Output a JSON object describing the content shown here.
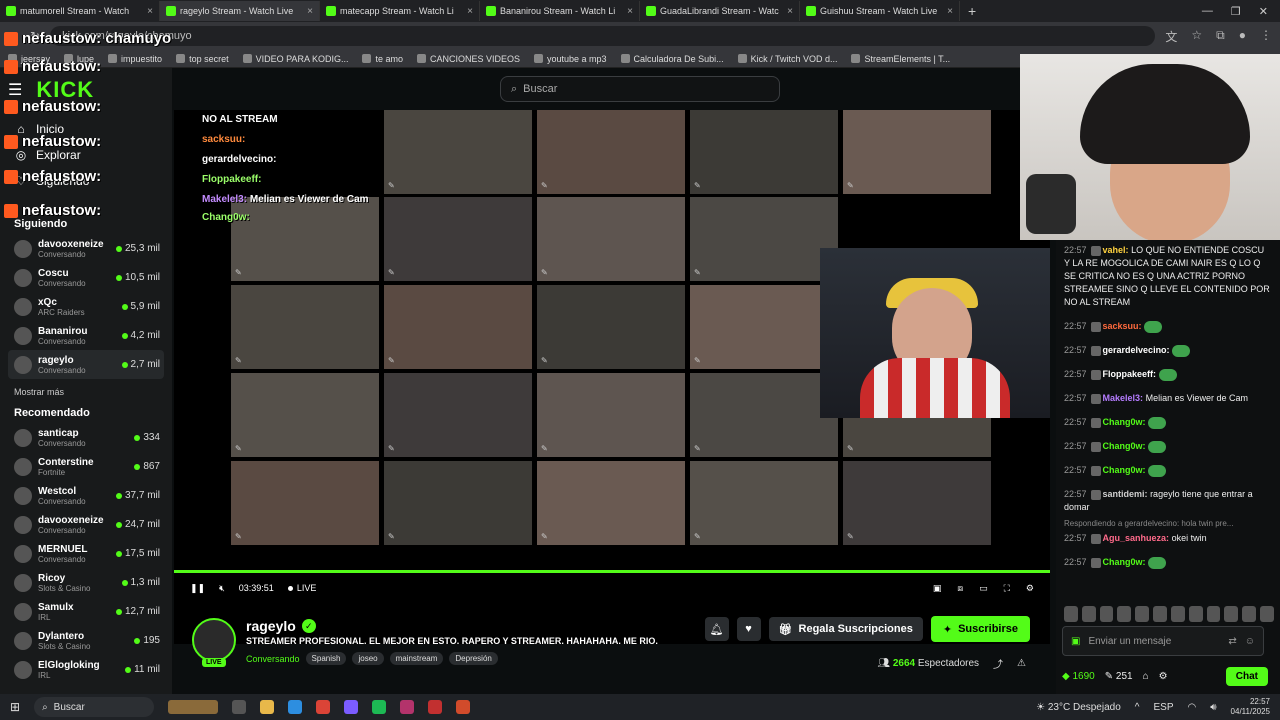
{
  "browser": {
    "tabs": [
      {
        "title": "matumorell Stream - Watch"
      },
      {
        "title": "rageylo Stream - Watch Live"
      },
      {
        "title": "matecapp Stream - Watch Li"
      },
      {
        "title": "Bananirou Stream - Watch Li"
      },
      {
        "title": "GuadaLibrandi Stream - Watc"
      },
      {
        "title": "Guishuu Stream - Watch Live"
      }
    ],
    "new_tab": "+",
    "address": "kick.com/rageylo/chamuyo",
    "bookmarks": [
      "jeersay",
      "lupe",
      "impuestito",
      "top secret",
      "VIDEO PARA KODIG...",
      "te amo",
      "CANCIONES VIDEOS",
      "youtube a mp3",
      "Calculadora De Subi...",
      "Kick / Twitch VOD d...",
      "StreamElements | T..."
    ]
  },
  "overlay_chat": [
    {
      "text": "nefaustow: chamuyo"
    },
    {
      "text": "nefaustow:"
    },
    {
      "text": "nefaustow:"
    },
    {
      "text": "nefaustow:"
    },
    {
      "text": "nefaustow:"
    },
    {
      "text": "nefaustow:"
    }
  ],
  "sidebar": {
    "logo": "KICK",
    "nav": [
      {
        "label": "Inicio",
        "icon": "home-icon"
      },
      {
        "label": "Explorar",
        "icon": "compass-icon"
      },
      {
        "label": "Siguiendo",
        "icon": "heart-icon"
      }
    ],
    "following_title": "Siguiendo",
    "following": [
      {
        "name": "davooxeneize",
        "cat": "Conversando",
        "viewers": "25,3 mil"
      },
      {
        "name": "Coscu",
        "cat": "Conversando",
        "viewers": "10,5 mil"
      },
      {
        "name": "xQc",
        "cat": "ARC Raiders",
        "viewers": "5,9 mil"
      },
      {
        "name": "Bananirou",
        "cat": "Conversando",
        "viewers": "4,2 mil"
      },
      {
        "name": "rageylo",
        "cat": "Conversando",
        "viewers": "2,7 mil"
      }
    ],
    "show_more": "Mostrar más",
    "recommended_title": "Recomendado",
    "recommended": [
      {
        "name": "santicap",
        "cat": "Conversando",
        "viewers": "334"
      },
      {
        "name": "Conterstine",
        "cat": "Fortnite",
        "viewers": "867"
      },
      {
        "name": "Westcol",
        "cat": "Conversando",
        "viewers": "37,7 mil"
      },
      {
        "name": "davooxeneize",
        "cat": "Conversando",
        "viewers": "24,7 mil"
      },
      {
        "name": "MERNUEL",
        "cat": "Conversando",
        "viewers": "17,5 mil"
      },
      {
        "name": "Ricoy",
        "cat": "Slots & Casino",
        "viewers": "1,3 mil"
      },
      {
        "name": "Samulx",
        "cat": "IRL",
        "viewers": "12,7 mil"
      },
      {
        "name": "Dylantero",
        "cat": "Slots & Casino",
        "viewers": "195"
      },
      {
        "name": "ElGlogloking",
        "cat": "IRL",
        "viewers": "11 mil"
      }
    ]
  },
  "search": {
    "placeholder": "Buscar"
  },
  "video_overlay": {
    "line1": "NO AL STREAM",
    "line2": "sacksuu:",
    "line3": "gerardelvecino:",
    "line4": "Floppakeeff:",
    "line5_user": "Makelel3:",
    "line5_text": "Melian es Viewer de Cam",
    "line6": "Chang0w:"
  },
  "player": {
    "time": "03:39:51",
    "live": "LIVE"
  },
  "stream": {
    "name": "rageylo",
    "live_badge": "LIVE",
    "title": "STREAMER PROFESIONAL. EL MEJOR EN ESTO. RAPERO Y STREAMER. HAHAHAHA. ME RIO.",
    "category": "Conversando",
    "tags": [
      "Spanish",
      "joseo",
      "mainstream",
      "Depresión"
    ],
    "gift_label": "Regala Suscripciones",
    "subscribe_label": "Suscribirse",
    "viewers_count": "2664",
    "viewers_label": "Espectadores"
  },
  "chat": {
    "messages": [
      {
        "time": "22:57",
        "user": "vahel:",
        "color": "#ffd23f",
        "text": "LO QUE NO ENTIENDE COSCU Y LA RE MOGOLICA DE CAMI NAIR ES Q LO Q SE CRITICA NO ES Q UNA ACTRIZ PORNO STREAMEE SINO Q LLEVE EL CONTENIDO POR NO AL STREAM"
      },
      {
        "time": "22:57",
        "user": "sacksuu:",
        "color": "#ff6a3d",
        "text": ""
      },
      {
        "time": "22:57",
        "user": "gerardelvecino:",
        "color": "#ffffff",
        "text": ""
      },
      {
        "time": "22:57",
        "user": "Floppakeeff:",
        "color": "#ffffff",
        "text": ""
      },
      {
        "time": "22:57",
        "user": "Makelel3:",
        "color": "#b57cff",
        "text": "Melian es Viewer de Cam"
      },
      {
        "time": "22:57",
        "user": "Chang0w:",
        "color": "#53fc18",
        "text": ""
      },
      {
        "time": "22:57",
        "user": "Chang0w:",
        "color": "#53fc18",
        "text": ""
      },
      {
        "time": "22:57",
        "user": "Chang0w:",
        "color": "#53fc18",
        "text": ""
      },
      {
        "time": "22:57",
        "user": "santidemi:",
        "color": "#cfcfcf",
        "text": "rageylo tiene que entrar a domar"
      },
      {
        "time": "22:57",
        "user": "Agu_sanhueza:",
        "color": "#ff6a8a",
        "text": "okei twin",
        "reply": "Respondiendo a gerardelvecino: hola twin pre..."
      },
      {
        "time": "22:57",
        "user": "Chang0w:",
        "color": "#53fc18",
        "text": ""
      }
    ],
    "input_placeholder": "Enviar un mensaje",
    "points": "1690",
    "tickets": "251",
    "chat_button": "Chat"
  },
  "taskbar": {
    "search": "Buscar",
    "weather": "23°C  Despejado",
    "lang": "ESP",
    "time": "22:57",
    "date": "04/11/2025"
  },
  "colors": {
    "accent": "#53fc18"
  }
}
